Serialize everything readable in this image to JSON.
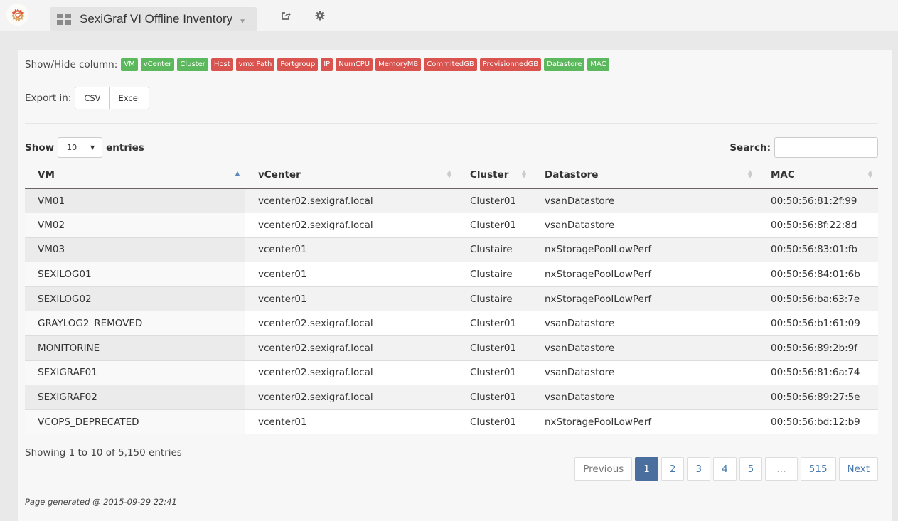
{
  "navbar": {
    "dashboard_title": "SexiGraf VI Offline Inventory",
    "icons": [
      "grafana-logo-icon",
      "dashboard-grid-icon",
      "caret-down-icon",
      "share-icon",
      "gear-icon"
    ]
  },
  "column_toggle": {
    "label": "Show/Hide column:",
    "columns": [
      {
        "name": "VM",
        "visible": true
      },
      {
        "name": "vCenter",
        "visible": true
      },
      {
        "name": "Cluster",
        "visible": true
      },
      {
        "name": "Host",
        "visible": false
      },
      {
        "name": "vmx Path",
        "visible": false
      },
      {
        "name": "Portgroup",
        "visible": false
      },
      {
        "name": "IP",
        "visible": false
      },
      {
        "name": "NumCPU",
        "visible": false
      },
      {
        "name": "MemoryMB",
        "visible": false
      },
      {
        "name": "CommitedGB",
        "visible": false
      },
      {
        "name": "ProvisionnedGB",
        "visible": false
      },
      {
        "name": "Datastore",
        "visible": true
      },
      {
        "name": "MAC",
        "visible": true
      }
    ],
    "colors": {
      "visible": "#5cb85c",
      "hidden": "#d9534f"
    }
  },
  "export": {
    "label": "Export in:",
    "csv": "CSV",
    "excel": "Excel"
  },
  "length": {
    "show": "Show",
    "value": "10",
    "entries": "entries"
  },
  "search": {
    "label": "Search:",
    "value": "",
    "placeholder": ""
  },
  "table": {
    "headers": [
      "VM",
      "vCenter",
      "Cluster",
      "Datastore",
      "MAC"
    ],
    "sorted_column": "VM",
    "sort_direction": "asc",
    "rows": [
      [
        "VM01",
        "vcenter02.sexigraf.local",
        "Cluster01",
        "vsanDatastore",
        "00:50:56:81:2f:99"
      ],
      [
        "VM02",
        "vcenter02.sexigraf.local",
        "Cluster01",
        "vsanDatastore",
        "00:50:56:8f:22:8d"
      ],
      [
        "VM03",
        "vcenter01",
        "Clustaire",
        "nxStoragePoolLowPerf",
        "00:50:56:83:01:fb"
      ],
      [
        "SEXILOG01",
        "vcenter01",
        "Clustaire",
        "nxStoragePoolLowPerf",
        "00:50:56:84:01:6b"
      ],
      [
        "SEXILOG02",
        "vcenter01",
        "Clustaire",
        "nxStoragePoolLowPerf",
        "00:50:56:ba:63:7e"
      ],
      [
        "GRAYLOG2_REMOVED",
        "vcenter02.sexigraf.local",
        "Cluster01",
        "vsanDatastore",
        "00:50:56:b1:61:09"
      ],
      [
        "MONITORINE",
        "vcenter02.sexigraf.local",
        "Cluster01",
        "vsanDatastore",
        "00:50:56:89:2b:9f"
      ],
      [
        "SEXIGRAF01",
        "vcenter02.sexigraf.local",
        "Cluster01",
        "vsanDatastore",
        "00:50:56:81:6a:74"
      ],
      [
        "SEXIGRAF02",
        "vcenter02.sexigraf.local",
        "Cluster01",
        "vsanDatastore",
        "00:50:56:89:27:5e"
      ],
      [
        "VCOPS_DEPRECATED",
        "vcenter01",
        "Cluster01",
        "nxStoragePoolLowPerf",
        "00:50:56:bd:12:b9"
      ]
    ]
  },
  "info": "Showing 1 to 10 of 5,150 entries",
  "pagination": {
    "previous": "Previous",
    "pages": [
      "1",
      "2",
      "3",
      "4",
      "5"
    ],
    "ellipsis": "…",
    "last": "515",
    "next": "Next",
    "current": "1",
    "active_color": "#4a6f9e"
  },
  "footer": {
    "generated": "Page generated @ 2015-09-29 22:41"
  }
}
